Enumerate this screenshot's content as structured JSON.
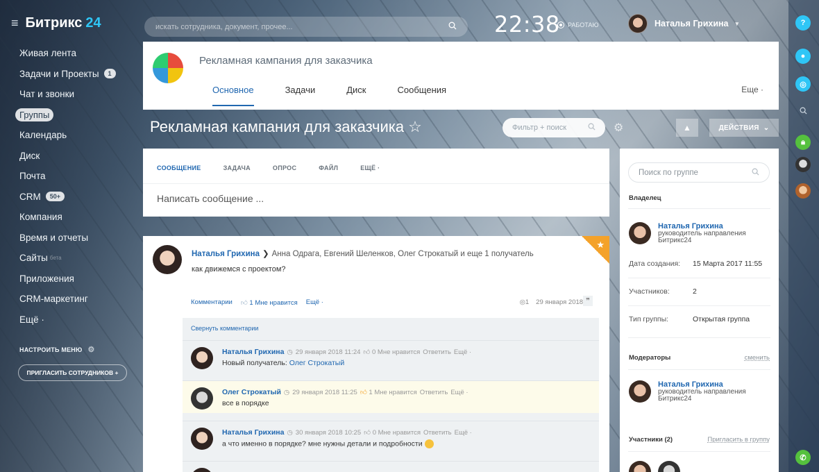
{
  "app": {
    "logo_name": "Битрикс",
    "logo_number": "24"
  },
  "sidebar": {
    "items": [
      {
        "label": "Живая лента"
      },
      {
        "label": "Задачи и Проекты",
        "counter": "1"
      },
      {
        "label": "Чат и звонки"
      },
      {
        "label": "Группы"
      },
      {
        "label": "Календарь"
      },
      {
        "label": "Диск"
      },
      {
        "label": "Почта"
      },
      {
        "label": "CRM",
        "counter": "50+"
      },
      {
        "label": "Компания"
      },
      {
        "label": "Время и отчеты"
      },
      {
        "label": "Сайты",
        "badge": "бета"
      },
      {
        "label": "Приложения"
      },
      {
        "label": "CRM-маркетинг"
      },
      {
        "label": "Ещё ·"
      }
    ],
    "configure_menu": "НАСТРОИТЬ МЕНЮ",
    "invite_button": "ПРИГЛАСИТЬ СОТРУДНИКОВ +"
  },
  "topbar": {
    "search_placeholder": "искать сотрудника, документ, прочее...",
    "clock": "22:38",
    "status": "РАБОТАЮ",
    "user_name": "Наталья Грихина"
  },
  "group": {
    "title": "Рекламная кампания для заказчика",
    "tabs": [
      "Основное",
      "Задачи",
      "Диск",
      "Сообщения"
    ],
    "more": "Еще ·"
  },
  "page": {
    "title": "Рекламная кампания для заказчика ☆",
    "filter_placeholder": "Фильтр + поиск",
    "actions": "ДЕЙСТВИЯ"
  },
  "post_form": {
    "tabs": [
      "СООБЩЕНИЕ",
      "ЗАДАЧА",
      "ОПРОС",
      "ФАЙЛ",
      "ЕЩЁ ·"
    ],
    "placeholder": "Написать сообщение ..."
  },
  "post": {
    "author": "Наталья Грихина",
    "recipients": "Анна Одрага, Евгений Шеленков, Олег Строкатый  и еще 1 получатель",
    "text": "как движемся с проектом?",
    "comments_link": "Комментарии",
    "likes": "1 Мне нравится",
    "more": "Ещё ·",
    "views": "1",
    "date": "29 января 2018 1",
    "collapse_comments": "Свернуть комментарии"
  },
  "comments": [
    {
      "author": "Наталья Грихина",
      "date": "29 января 2018 11:24",
      "likes": "0 Мне нравится",
      "reply": "Ответить",
      "more": "Ещё ·",
      "text": "Новый получатель: ",
      "link": "Олег Строкатый"
    },
    {
      "author": "Олег Строкатый",
      "date": "29 января 2018 11:25",
      "likes": "1 Мне нравится",
      "reply": "Ответить",
      "more": "Ещё ·",
      "text": "все в порядке",
      "link": ""
    },
    {
      "author": "Наталья Грихина",
      "date": "30 января 2018 10:25",
      "likes": "0 Мне нравится",
      "reply": "Ответить",
      "more": "Ещё ·",
      "text": "а что именно в порядке? мне нужны детали и подробности",
      "link": ""
    }
  ],
  "right_panel": {
    "search_placeholder": "Поиск по группе",
    "owner_label": "Владелец",
    "owner_name": "Наталья Грихина",
    "owner_role": "руководитель направления Битрикс24",
    "created_label": "Дата создания:",
    "created_value": "15 Марта 2017 11:55",
    "members_label": "Участников:",
    "members_value": "2",
    "type_label": "Тип группы:",
    "type_value": "Открытая группа",
    "moderators_label": "Модераторы",
    "change_link": "сменить",
    "moderator_name": "Наталья Грихина",
    "moderator_role": "руководитель направления Битрикс24",
    "participants_label": "Участники (2)",
    "invite_link": "Пригласить в группу"
  },
  "colors": {
    "accent": "#2067b0",
    "brand": "#2fc6f6",
    "favorite": "#f4a22a"
  }
}
